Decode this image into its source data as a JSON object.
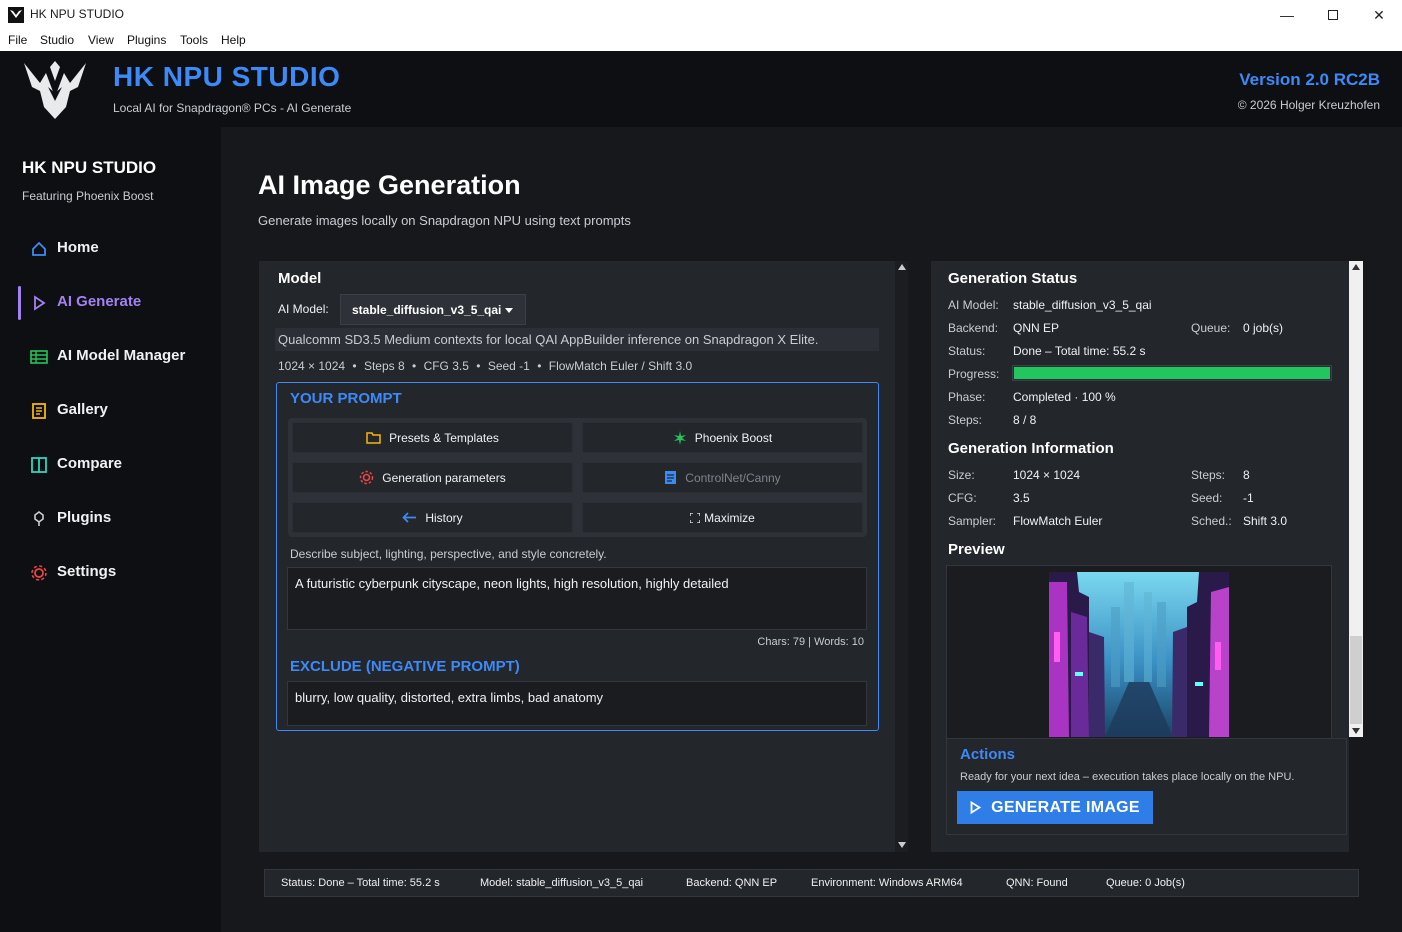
{
  "window": {
    "title": "HK NPU STUDIO",
    "minimize_icon": "minimize-icon",
    "maximize_icon": "maximize-icon",
    "close_icon": "close-icon"
  },
  "menu": [
    "File",
    "Studio",
    "View",
    "Plugins",
    "Tools",
    "Help"
  ],
  "header": {
    "brand": "HK NPU STUDIO",
    "tagline": "Local AI for Snapdragon® PCs - AI Generate",
    "version": "Version 2.0 RC2B",
    "copyright": "© 2026 Holger Kreuzhofen"
  },
  "sidebar": {
    "title": "HK NPU STUDIO",
    "subtitle": "Featuring Phoenix Boost",
    "items": [
      {
        "label": "Home",
        "icon": "home-icon"
      },
      {
        "label": "AI Generate",
        "icon": "play-icon",
        "active": true
      },
      {
        "label": "AI Model Manager",
        "icon": "list-icon"
      },
      {
        "label": "Gallery",
        "icon": "gallery-icon"
      },
      {
        "label": "Compare",
        "icon": "compare-icon"
      },
      {
        "label": "Plugins",
        "icon": "plugin-icon"
      },
      {
        "label": "Settings",
        "icon": "gear-icon"
      }
    ]
  },
  "page": {
    "title": "AI Image Generation",
    "subtitle": "Generate images locally on Snapdragon NPU using text prompts"
  },
  "model": {
    "section_title": "Model",
    "label": "AI Model:",
    "selected": "stable_diffusion_v3_5_qai",
    "description": "Qualcomm SD3.5 Medium contexts for local QAI AppBuilder inference on Snapdragon X Elite.",
    "spec_size": "1024 × 1024",
    "spec_steps": "Steps 8",
    "spec_cfg": "CFG 3.5",
    "spec_seed": "Seed -1",
    "spec_sampler": "FlowMatch Euler / Shift 3.0",
    "spec_sep": "•"
  },
  "prompt": {
    "title": "YOUR PROMPT",
    "buttons": {
      "presets": "Presets & Templates",
      "phoenix": "Phoenix Boost",
      "params": "Generation parameters",
      "controlnet": "ControlNet/Canny",
      "history": "History",
      "maximize": "Maximize"
    },
    "hint": "Describe subject, lighting, perspective, and style concretely.",
    "text": "A futuristic cyberpunk cityscape, neon lights, high resolution, highly detailed",
    "counter": "Chars: 79 | Words: 10",
    "negative_title": "EXCLUDE (NEGATIVE PROMPT)",
    "negative_text": "blurry, low quality, distorted, extra limbs, bad anatomy"
  },
  "status": {
    "section_title": "Generation Status",
    "model_label": "AI Model:",
    "model_value": "stable_diffusion_v3_5_qai",
    "backend_label": "Backend:",
    "backend_value": "QNN EP",
    "queue_label": "Queue:",
    "queue_value": "0 job(s)",
    "status_label": "Status:",
    "status_value": "Done – Total time: 55.2 s",
    "progress_label": "Progress:",
    "progress_percent": 100,
    "phase_label": "Phase:",
    "phase_value": "Completed · 100 %",
    "steps_label": "Steps:",
    "steps_value": "8 / 8",
    "accent": "#22c55e"
  },
  "info": {
    "section_title": "Generation Information",
    "size_label": "Size:",
    "size_value": "1024 × 1024",
    "steps_label": "Steps:",
    "steps_value": "8",
    "cfg_label": "CFG:",
    "cfg_value": "3.5",
    "seed_label": "Seed:",
    "seed_value": "-1",
    "sampler_label": "Sampler:",
    "sampler_value": "FlowMatch Euler",
    "sched_label": "Sched.:",
    "sched_value": "Shift 3.0"
  },
  "preview": {
    "title": "Preview"
  },
  "actions": {
    "title": "Actions",
    "hint": "Ready for your next idea – execution takes place locally on the NPU.",
    "generate": "GENERATE IMAGE"
  },
  "statusbar": {
    "status": "Status: Done – Total time: 55.2 s",
    "model": "Model: stable_diffusion_v3_5_qai",
    "backend": "Backend: QNN EP",
    "environment": "Environment: Windows ARM64",
    "qnn": "QNN: Found",
    "queue": "Queue: 0 Job(s)"
  },
  "colors": {
    "accent_blue": "#3d8af7",
    "accent_purple": "#a481f2",
    "success": "#22c55e"
  }
}
